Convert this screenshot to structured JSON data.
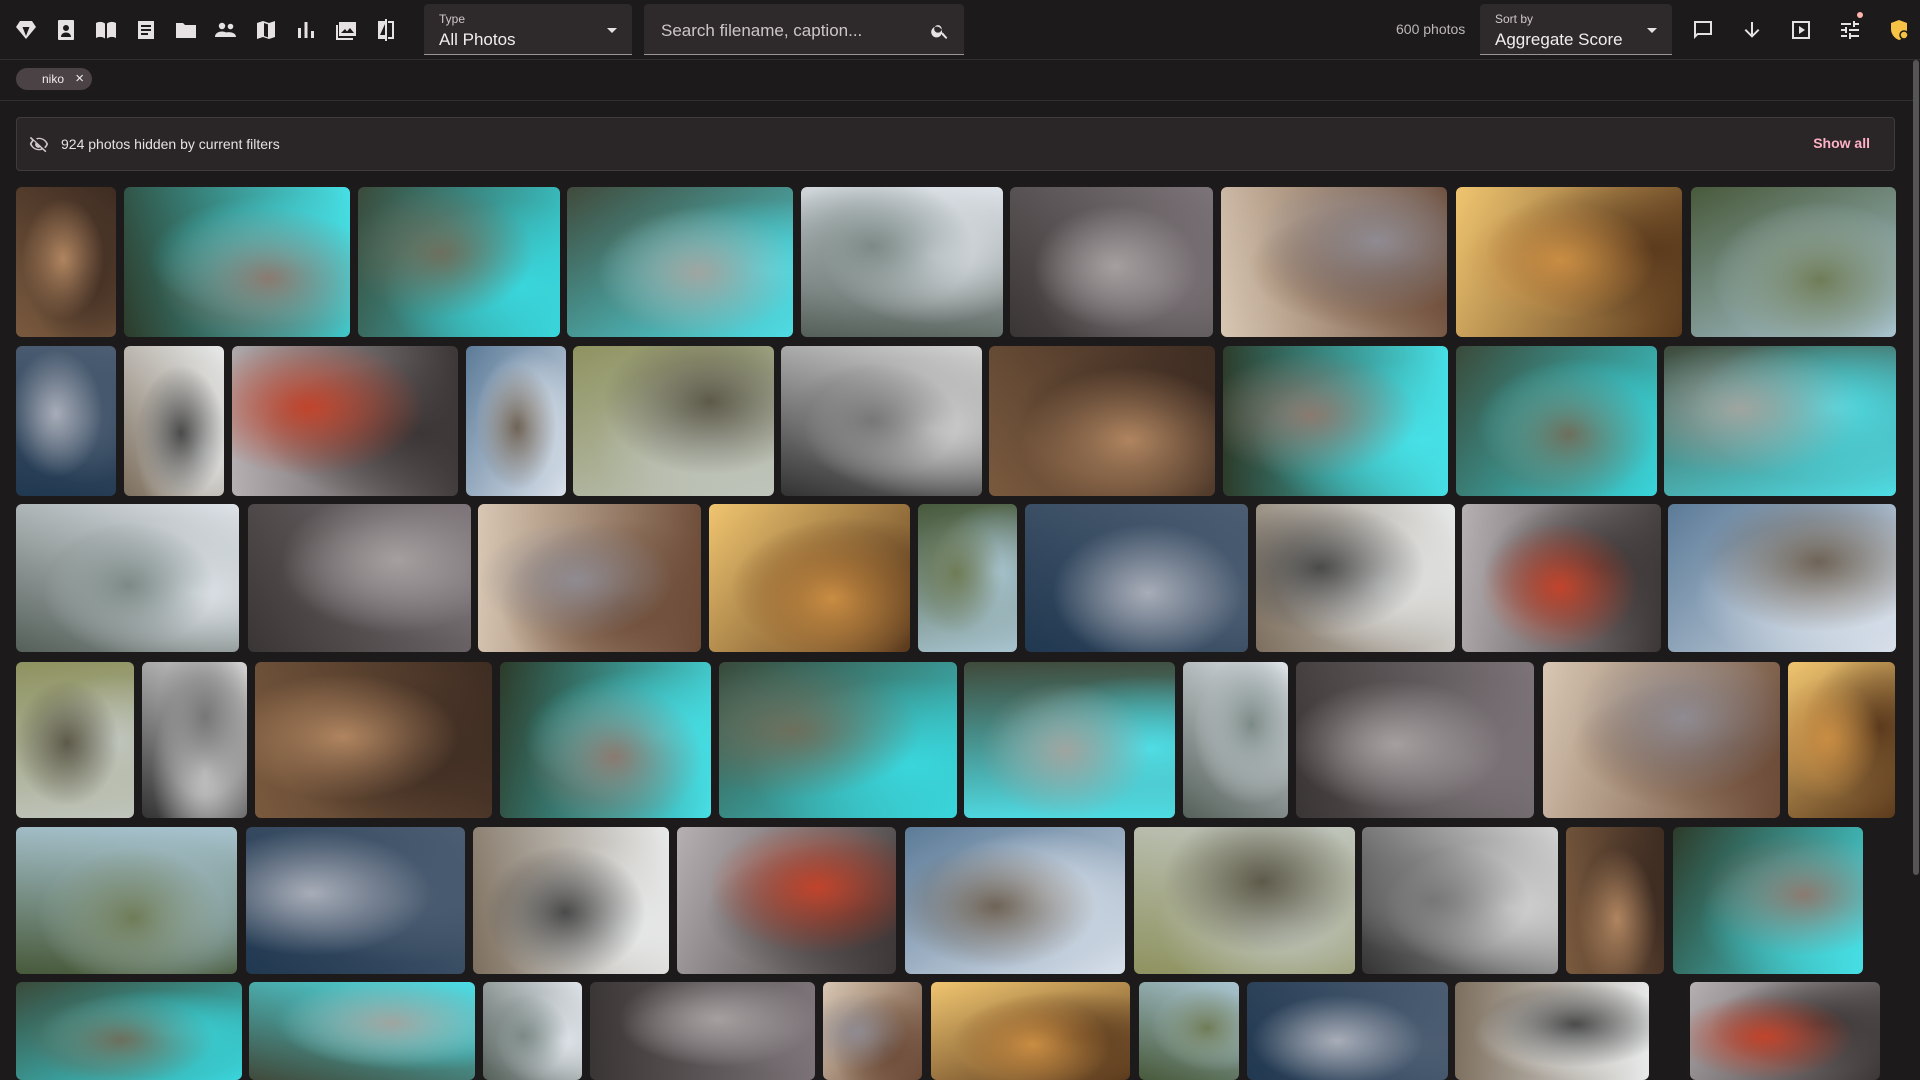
{
  "nav": {
    "icons": [
      "diamond-icon",
      "portrait-icon",
      "book-icon",
      "article-icon",
      "folder-icon",
      "people-icon",
      "map-icon",
      "chart-icon",
      "photo-library-icon",
      "compare-icon"
    ]
  },
  "type_filter": {
    "label": "Type",
    "value": "All Photos"
  },
  "search": {
    "placeholder": "Search filename, caption..."
  },
  "photo_count": "600 photos",
  "sort": {
    "label": "Sort by",
    "value": "Aggregate Score"
  },
  "right_icons": [
    "comment-icon",
    "arrow-down-icon",
    "slideshow-icon",
    "tune-icon",
    "notification-badge-icon"
  ],
  "chips": [
    {
      "label": "niko"
    }
  ],
  "banner": {
    "message": "924 photos hidden by current filters",
    "action": "Show all"
  },
  "colors": {
    "background": "#1d1a1b",
    "accent": "#ffb1c5",
    "surface": "#2e2a2c"
  }
}
